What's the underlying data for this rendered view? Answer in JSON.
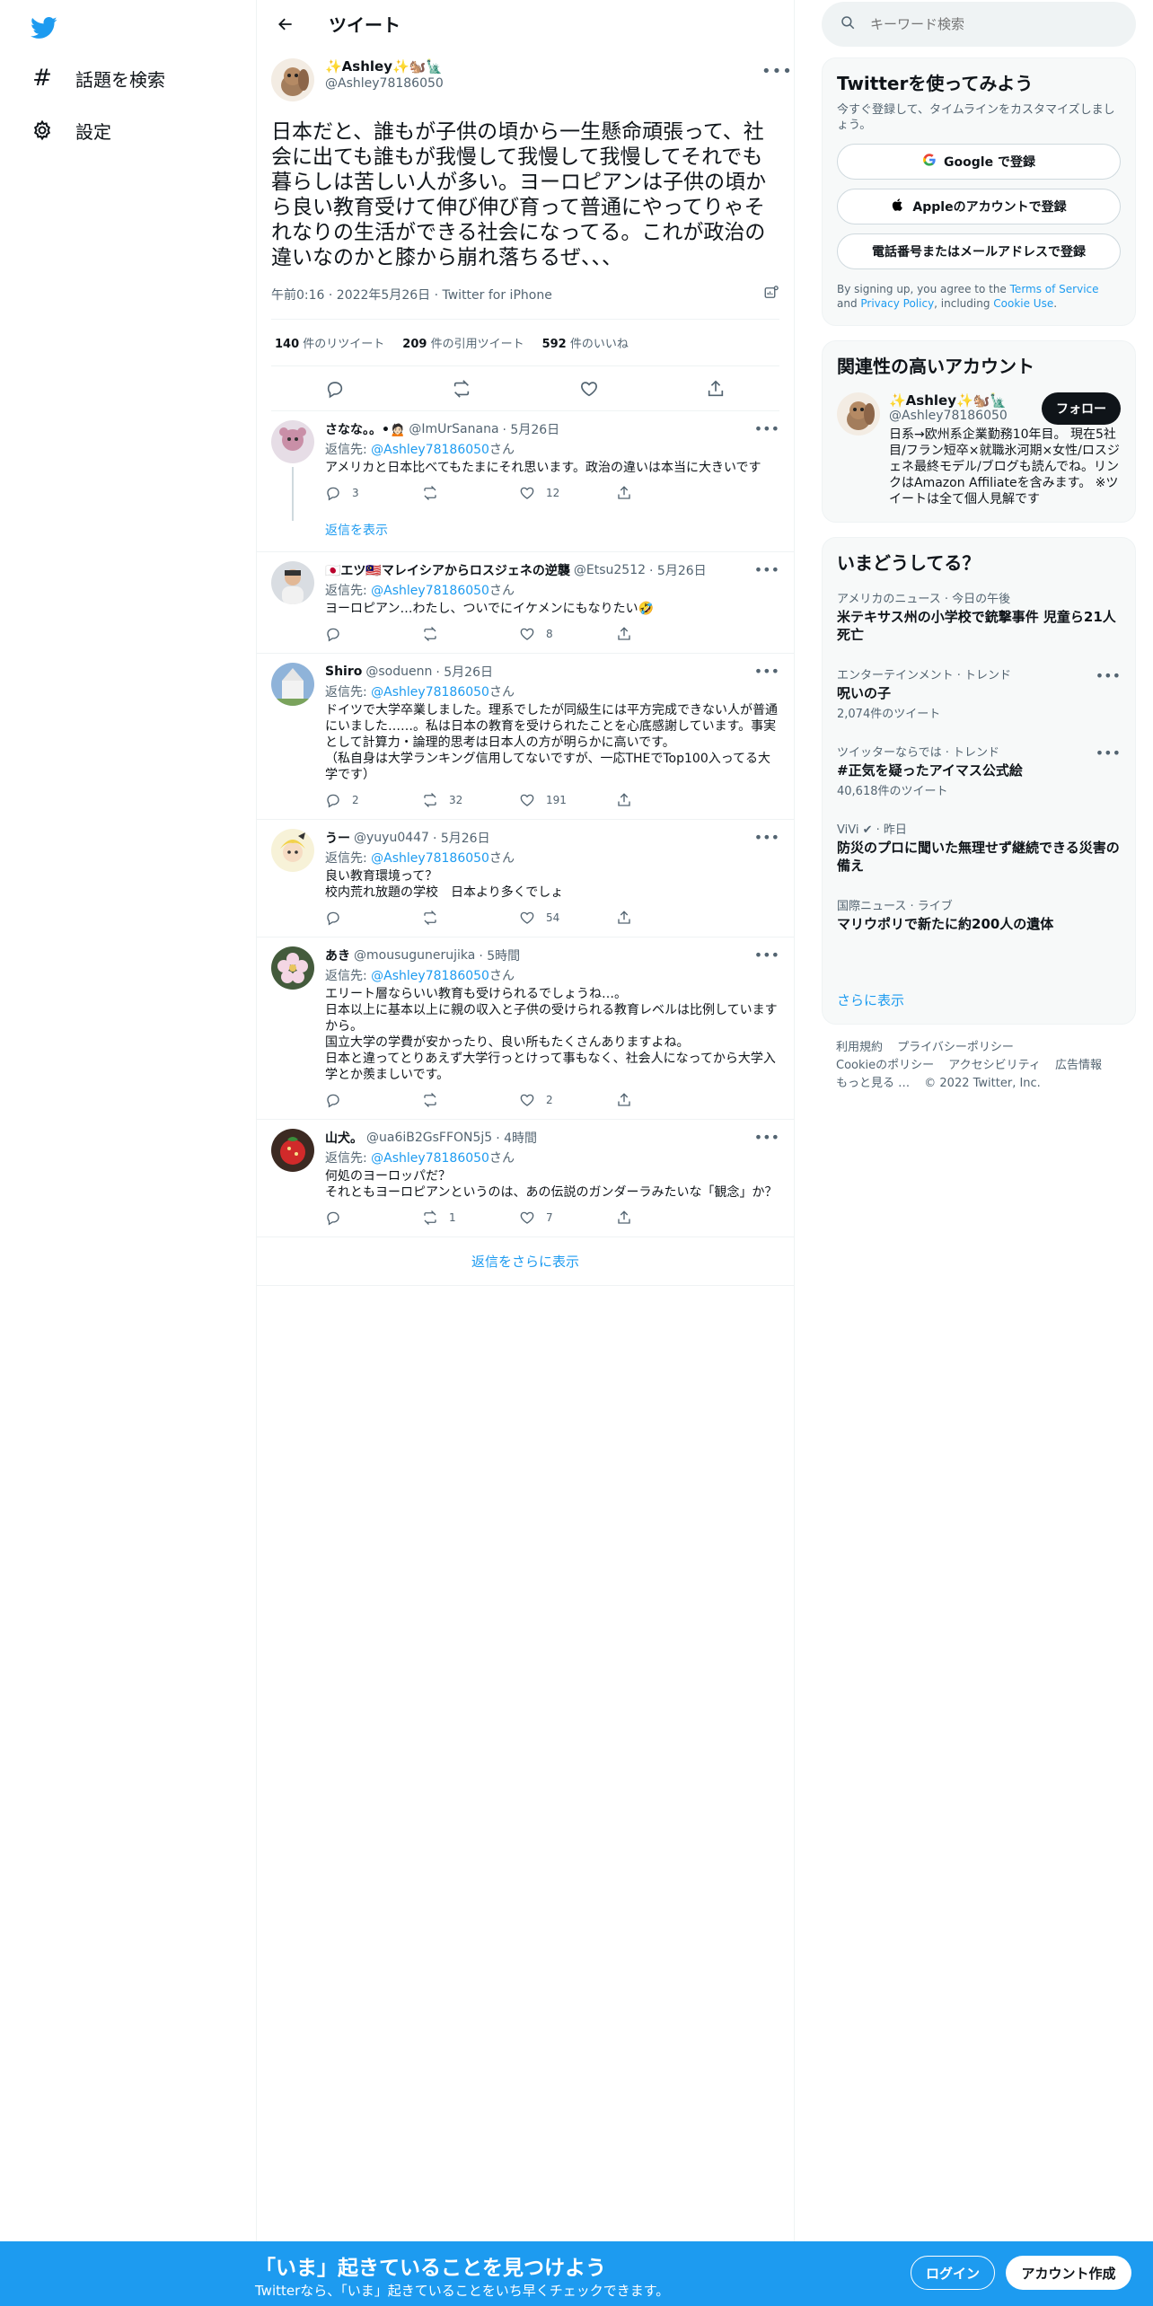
{
  "nav": {
    "logo": "twitter-bird",
    "items": [
      {
        "label": "話題を検索",
        "icon": "#"
      },
      {
        "label": "設定",
        "icon": "⚙"
      }
    ]
  },
  "header": {
    "title": "ツイート"
  },
  "tweet": {
    "name": "✨Ashley✨🐿️🗽",
    "handle": "@Ashley78186050",
    "text": "日本だと、誰もが子供の頃から一生懸命頑張って、社会に出ても誰もが我慢して我慢して我慢してそれでも暮らしは苦しい人が多い。ヨーロピアンは子供の頃から良い教育受けて伸び伸び育って普通にやってりゃそれなりの生活ができる社会になってる。これが政治の違いなのかと膝から崩れ落ちるぜ、、、",
    "meta": "午前0:16 · 2022年5月26日 · Twitter for iPhone",
    "stats": [
      {
        "count": "140",
        "label": "件のリツイート"
      },
      {
        "count": "209",
        "label": "件の引用ツイート"
      },
      {
        "count": "592",
        "label": "件のいいね"
      }
    ]
  },
  "replies": [
    {
      "name": "さなな。。•🙍🏻",
      "handle": "@ImUrSanana",
      "date": "· 5月26日",
      "reply_prefix": "返信先: ",
      "reply_to": "@Ashley78186050",
      "reply_suffix": "さん",
      "text": "アメリカと日本比べてもたまにそれ思います。政治の違いは本当に大きいです",
      "reply_count": "3",
      "rt_count": "",
      "like_count": "12",
      "show_replies": "返信を表示"
    },
    {
      "name": "🇯🇵エツ🇲🇾マレイシアからロスジェネの逆襲",
      "handle": "@Etsu2512",
      "date": "· 5月26日",
      "reply_prefix": "返信先: ",
      "reply_to": "@Ashley78186050",
      "reply_suffix": "さん",
      "text": "ヨーロピアン…わたし、ついでにイケメンにもなりたい🤣",
      "reply_count": "",
      "rt_count": "",
      "like_count": "8"
    },
    {
      "name": "Shiro",
      "handle": "@soduenn",
      "date": "· 5月26日",
      "reply_prefix": "返信先: ",
      "reply_to": "@Ashley78186050",
      "reply_suffix": "さん",
      "text": "ドイツで大学卒業しました。理系でしたが同級生には平方完成できない人が普通にいました……。私は日本の教育を受けられたことを心底感謝しています。事実として計算力・論理的思考は日本人の方が明らかに高いです。\n（私自身は大学ランキング信用してないですが、一応THEでTop100入ってる大学です）",
      "reply_count": "2",
      "rt_count": "32",
      "like_count": "191"
    },
    {
      "name": "うー",
      "handle": "@yuyu0447",
      "date": "· 5月26日",
      "reply_prefix": "返信先: ",
      "reply_to": "@Ashley78186050",
      "reply_suffix": "さん",
      "text": "良い教育環境って？\n校内荒れ放題の学校　日本より多くでしょ",
      "reply_count": "",
      "rt_count": "",
      "like_count": "54"
    },
    {
      "name": "あき",
      "handle": "@mousugunerujika",
      "date": "· 5時間",
      "reply_prefix": "返信先: ",
      "reply_to": "@Ashley78186050",
      "reply_suffix": "さん",
      "text": "エリート層ならいい教育も受けられるでしょうね…。\n日本以上に基本以上に親の収入と子供の受けられる教育レベルは比例していますから。\n国立大学の学費が安かったり、良い所もたくさんありますよね。\n日本と違ってとりあえず大学行っとけって事もなく、社会人になってから大学入学とか羨ましいです。",
      "reply_count": "",
      "rt_count": "",
      "like_count": "2"
    },
    {
      "name": "山犬。",
      "handle": "@ua6iB2GsFFON5j5",
      "date": "· 4時間",
      "reply_prefix": "返信先: ",
      "reply_to": "@Ashley78186050",
      "reply_suffix": "さん",
      "text": "何処のヨーロッパだ？\nそれともヨーロピアンというのは、あの伝説のガンダーラみたいな「観念」か？",
      "reply_count": "",
      "rt_count": "1",
      "like_count": "7"
    }
  ],
  "more_replies": "返信をさらに表示",
  "right": {
    "search_placeholder": "キーワード検索",
    "signup": {
      "title": "Twitterを使ってみよう",
      "sub": "今すぐ登録して、タイムラインをカスタマイズしましょう。",
      "google": "Google で登録",
      "apple": "Appleのアカウントで登録",
      "phone": "電話番号またはメールアドレスで登録",
      "terms_prefix": "By signing up, you agree to the ",
      "terms_link": "Terms of Service",
      "terms_and": " and ",
      "privacy_link": "Privacy Policy",
      "terms_including": ", including ",
      "cookie_link": "Cookie Use",
      "terms_end": "."
    },
    "related": {
      "title": "関連性の高いアカウント",
      "name": "✨Ashley✨🐿️🗽",
      "handle": "@Ashley78186050",
      "follow": "フォロー",
      "bio": "日系→欧州系企業勤務10年目。 現在5社目/フラン短卒×就職氷河期×女性/ロスジェネ最終モデル/ブログも読んでね。リンクはAmazon Affiliateを含みます。 ※ツイートは全て個人見解です"
    },
    "trends": {
      "title": "いまどうしてる？",
      "items": [
        {
          "cat": "アメリカのニュース · 今日の午後",
          "title": "米テキサス州の小学校で銃撃事件 児童ら21人死亡",
          "count": ""
        },
        {
          "cat": "エンターテインメント · トレンド",
          "title": "呪いの子",
          "count": "2,074件のツイート"
        },
        {
          "cat": "ツイッターならでは · トレンド",
          "title": "#正気を疑ったアイマス公式絵",
          "count": "40,618件のツイート"
        },
        {
          "cat": "ViVi ✔ · 昨日",
          "title": "防災のプロに聞いた無理せず継続できる災害の備え",
          "count": ""
        },
        {
          "cat": "国際ニュース · ライブ",
          "title": "マリウポリで新たに約200人の遺体",
          "count": ""
        }
      ],
      "show_more": "さらに表示"
    },
    "footer": [
      "利用規約",
      "プライバシーポリシー",
      "Cookieのポリシー",
      "アクセシビリティ",
      "広告情報",
      "もっと見る …",
      "© 2022 Twitter, Inc."
    ]
  },
  "bottom": {
    "title": "「いま」起きていることを見つけよう",
    "sub": "Twitterなら、「いま」起きていることをいち早くチェックできます。",
    "login": "ログイン",
    "signup": "アカウント作成"
  },
  "colors": {
    "accent": "#1d9bf0",
    "text": "#0f1419",
    "muted": "#536471",
    "border": "#eff3f4"
  }
}
